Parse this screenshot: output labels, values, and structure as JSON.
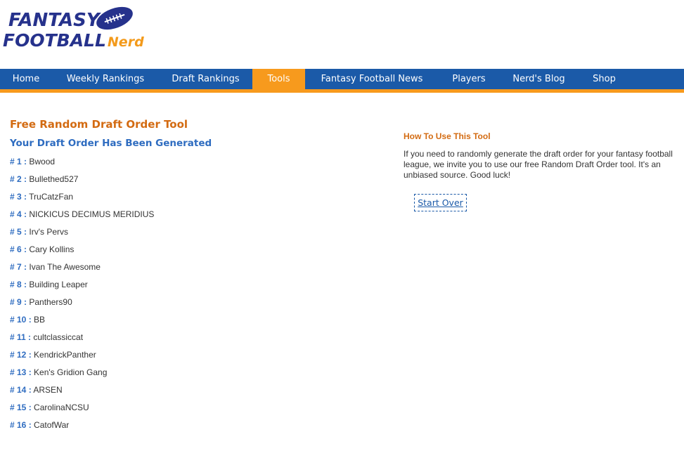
{
  "logo": {
    "line1": "FANTASY",
    "line2": "FOOTBALL",
    "line2_suffix": "Nerd",
    "icon": "football-icon"
  },
  "nav": {
    "items": [
      {
        "label": "Home"
      },
      {
        "label": "Weekly Rankings"
      },
      {
        "label": "Draft Rankings"
      },
      {
        "label": "Tools",
        "active": true
      },
      {
        "label": "Fantasy Football News"
      },
      {
        "label": "Players"
      },
      {
        "label": "Nerd's Blog"
      },
      {
        "label": "Shop"
      }
    ]
  },
  "main": {
    "tool_title": "Free Random Draft Order Tool",
    "generated_title": "Your Draft Order Has Been Generated",
    "order": [
      {
        "num": "# 1 :",
        "name": "Bwood"
      },
      {
        "num": "# 2 :",
        "name": "Bullethed527"
      },
      {
        "num": "# 3 :",
        "name": "TruCatzFan"
      },
      {
        "num": "# 4 :",
        "name": "NICKICUS DECIMUS MERIDIUS"
      },
      {
        "num": "# 5 :",
        "name": "Irv's Pervs"
      },
      {
        "num": "# 6 :",
        "name": "Cary Kollins"
      },
      {
        "num": "# 7 :",
        "name": "Ivan The Awesome"
      },
      {
        "num": "# 8 :",
        "name": "Building Leaper"
      },
      {
        "num": "# 9 :",
        "name": "Panthers90"
      },
      {
        "num": "# 10 :",
        "name": "BB"
      },
      {
        "num": "# 11 :",
        "name": "cultclassiccat"
      },
      {
        "num": "# 12 :",
        "name": "KendrickPanther"
      },
      {
        "num": "# 13 :",
        "name": "Ken's Gridion Gang"
      },
      {
        "num": "# 14 :",
        "name": "ARSEN"
      },
      {
        "num": "# 15 :",
        "name": "CarolinaNCSU"
      },
      {
        "num": "# 16 :",
        "name": "CatofWar"
      }
    ]
  },
  "sidebar": {
    "howto_title": "How To Use This Tool",
    "howto_text": "If you need to randomly generate the draft order for your fantasy football league, we invite you to use our free Random Draft Order tool. It's an unbiased source. Good luck!",
    "start_over_label": "Start Over"
  },
  "colors": {
    "nav_bg": "#1b5aa8",
    "accent_orange": "#f79a1d",
    "title_orange": "#d36b12",
    "link_blue": "#2e6cc0",
    "logo_navy": "#26328c"
  }
}
